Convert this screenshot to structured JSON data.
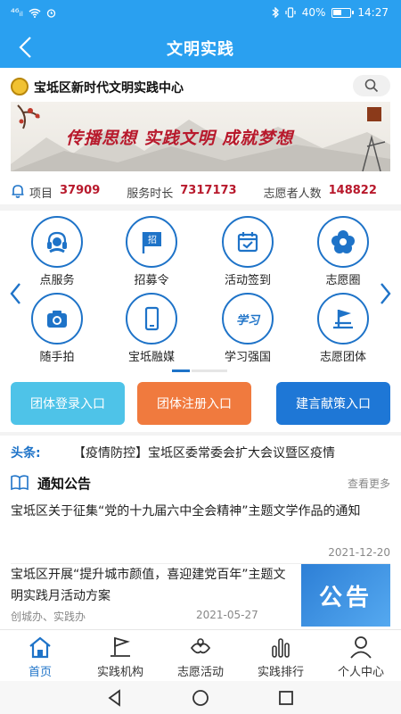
{
  "status_bar": {
    "signal": "⁴⁶ᵢₗ",
    "battery_percent": "40%",
    "time": "14:27"
  },
  "nav": {
    "title": "文明实践"
  },
  "header": {
    "org_name": "宝坻区新时代文明实践中心"
  },
  "banner": {
    "slogan": "传播思想  实践文明  成就梦想"
  },
  "stats": [
    {
      "label": "项目",
      "value": "37909"
    },
    {
      "label": "服务时长",
      "value": "7317173"
    },
    {
      "label": "志愿者人数",
      "value": "148822"
    }
  ],
  "grid": [
    {
      "label": "点服务",
      "icon": "headset-icon"
    },
    {
      "label": "招募令",
      "icon": "flag-icon"
    },
    {
      "label": "活动签到",
      "icon": "calendar-check-icon"
    },
    {
      "label": "志愿圈",
      "icon": "flower-icon"
    },
    {
      "label": "随手拍",
      "icon": "camera-icon"
    },
    {
      "label": "宝坻融媒",
      "icon": "phone-icon"
    },
    {
      "label": "学习强国",
      "icon": "xuexi-icon"
    },
    {
      "label": "志愿团体",
      "icon": "team-flag-icon"
    }
  ],
  "flag_glyph": "招",
  "xuexi_glyph": "学习",
  "buttons": {
    "team_login": "团体登录入口",
    "team_register": "团体注册入口",
    "suggest": "建言献策入口"
  },
  "headline": {
    "tag": "头条:",
    "text": "【疫情防控】宝坻区委常委会扩大会议暨区疫情"
  },
  "notices": {
    "title": "通知公告",
    "more": "查看更多",
    "items": [
      {
        "title": "宝坻区关于征集“党的十九届六中全会精神”主题文学作品的通知",
        "date": "2021-12-20"
      },
      {
        "title": "宝坻区开展“提升城市颜值，喜迎建党百年”主题文明实践月活动方案",
        "source": "创城办、实践办",
        "date": "2021-05-27",
        "thumb_text": "公告"
      }
    ]
  },
  "tabs": [
    {
      "label": "首页",
      "active": true
    },
    {
      "label": "实践机构",
      "active": false
    },
    {
      "label": "志愿活动",
      "active": false
    },
    {
      "label": "实践排行",
      "active": false
    },
    {
      "label": "个人中心",
      "active": false
    }
  ],
  "colors": {
    "primary": "#2aa0f0",
    "accent_red": "#b8192c",
    "icon_blue": "#1e73c8"
  }
}
